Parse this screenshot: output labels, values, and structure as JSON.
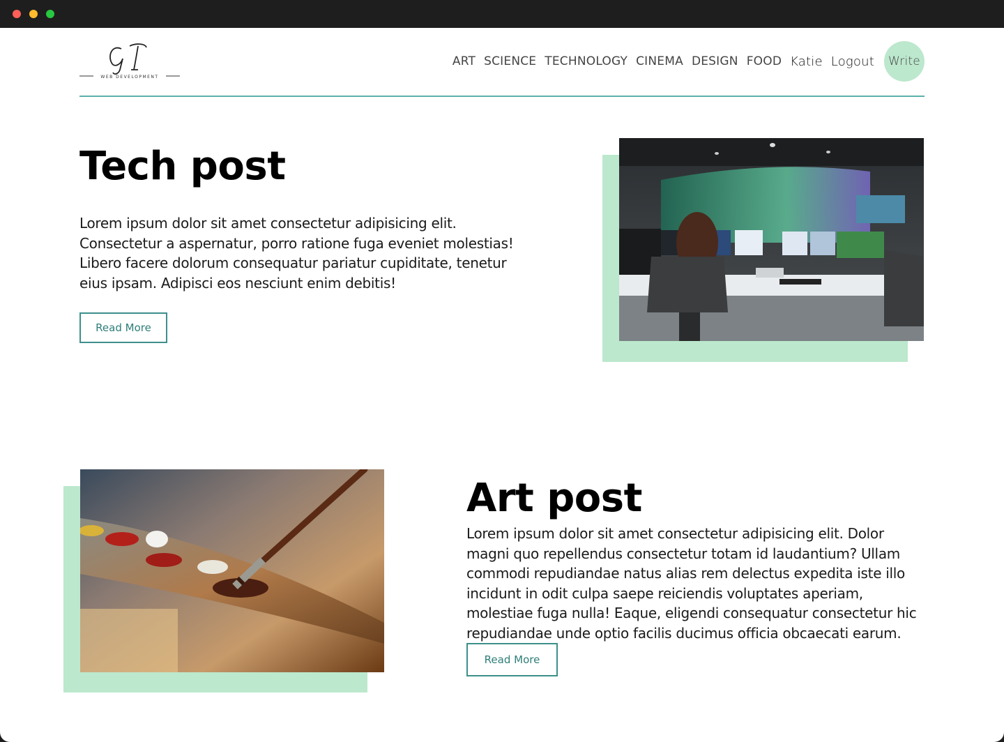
{
  "logo": {
    "monogram": "GI",
    "tagline": "WEB DEVELOPMENT"
  },
  "nav": {
    "categories": [
      "ART",
      "SCIENCE",
      "TECHNOLOGY",
      "CINEMA",
      "DESIGN",
      "FOOD"
    ],
    "user": "Katie",
    "logout": "Logout",
    "write": "Write"
  },
  "posts": [
    {
      "title": "Tech post",
      "body_lines": [
        "Lorem ipsum dolor sit amet consectetur adipisicing elit.",
        "Consectetur a aspernatur, porro ratione fuga eveniet molestias!",
        "Libero facere dolorum consequatur pariatur cupiditate, tenetur",
        "eius ipsam. Adipisci eos nesciunt enim debitis!"
      ],
      "button": "Read More",
      "image": "control-room-photo"
    },
    {
      "title": "Art post",
      "body_lines": [
        "Lorem ipsum dolor sit amet consectetur adipisicing elit. Dolor",
        "magni quo repellendus consectetur totam id laudantium? Ullam",
        "commodi repudiandae natus alias rem delectus expedita iste illo",
        "incidunt in odit culpa saepe reiciendis voluptates aperiam,",
        "molestiae fuga nulla! Eaque, eligendi consequatur consectetur hic",
        "repudiandae unde optio facilis ducimus officia obcaecati earum."
      ],
      "button": "Read More",
      "image": "paint-palette-photo"
    }
  ],
  "colors": {
    "accent": "#bce8cd",
    "teal": "#3d8f8a",
    "rule": "#5bb0aa"
  }
}
